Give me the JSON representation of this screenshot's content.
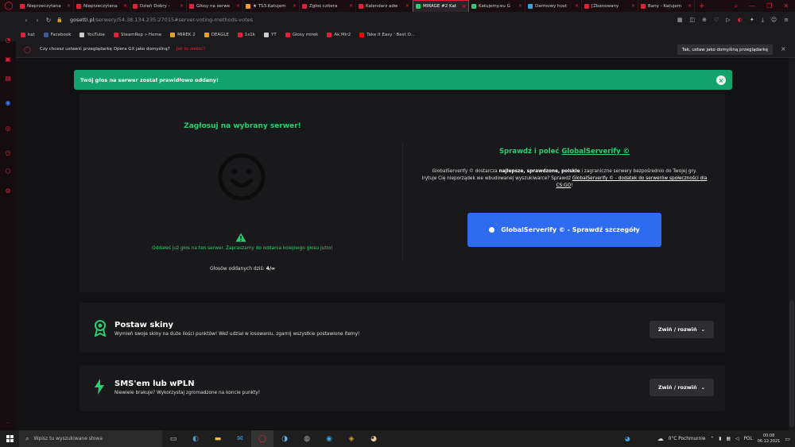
{
  "browser": {
    "tabs": [
      {
        "title": "Nieprzeczytana",
        "color": "#e0203a",
        "active": false
      },
      {
        "title": "Nieprzeczytana",
        "color": "#e0203a",
        "active": false
      },
      {
        "title": "Dzień Dobry - ",
        "color": "#e0203a",
        "active": false
      },
      {
        "title": "Głosy na serwe",
        "color": "#e0203a",
        "active": false
      },
      {
        "title": "★ TS3.Katujem",
        "color": "#f0a020",
        "active": false
      },
      {
        "title": "Zgłoś czitera",
        "color": "#e0203a",
        "active": false
      },
      {
        "title": "Kalendarz adw",
        "color": "#e0203a",
        "active": false
      },
      {
        "title": "MIRAGE #2 Kat",
        "color": "#2ecc71",
        "active": true
      },
      {
        "title": "Katujemy.eu G",
        "color": "#2ecc71",
        "active": false
      },
      {
        "title": "Darmowy host",
        "color": "#3aa0e0",
        "active": false
      },
      {
        "title": "[Zbanowany",
        "color": "#e0203a",
        "active": false
      },
      {
        "title": "Bany - Katujem",
        "color": "#e0203a",
        "active": false
      }
    ],
    "new_tab": "+",
    "url_host": "gosetti.pl",
    "url_path": "/serwery/54.38.134.235:27015#server-voting-methods-votes",
    "bookmarks": [
      {
        "label": "kat",
        "color": "#e0203a"
      },
      {
        "label": "Facebook",
        "color": "#3b5998"
      },
      {
        "label": "YouTube",
        "color": "#cccccc"
      },
      {
        "label": "SteamRep » Home",
        "color": "#e0203a"
      },
      {
        "label": "MIREK 2",
        "color": "#f0a020"
      },
      {
        "label": "DEAGLE",
        "color": "#f0a020"
      },
      {
        "label": "1s1k",
        "color": "#e0203a"
      },
      {
        "label": "YT",
        "color": "#cccccc"
      },
      {
        "label": "Głosy mirek",
        "color": "#e0203a"
      },
      {
        "label": "Ak Mir2",
        "color": "#e0203a"
      },
      {
        "label": "Take It Easy ' Best O...",
        "color": "#ff0000"
      }
    ],
    "infobar": {
      "message": "Czy chcesz ustawić przeglądarkę Opera GX jako domyślną?",
      "why_link": "Jak to zrobić?",
      "set_button": "Tak, ustaw jako domyślną przeglądarkę",
      "close": "×"
    }
  },
  "alert": {
    "text": "Twój głos na serwer został prawidłowo oddany!",
    "close": "×",
    "color": "#13a26d"
  },
  "vote": {
    "title": "Zagłosuj na wybrany serwer!",
    "message": "Oddałeś już głos na ten serwer. Zapraszamy do oddania kolejnego głosu jutro!",
    "votes_today_label": "Głosów oddanych dziś:",
    "votes_today_value": "4/∞"
  },
  "globalserverify": {
    "title_prefix": "Sprawdź i poleć ",
    "title_link": "GlobalServerify ©",
    "desc_1": "GlobalServerify © dostarcza ",
    "desc_bold_1": "najlepsze, sprawdzone, polskie",
    "desc_2": " i zagraniczne serwery bezpośrednio do Twojej gry.",
    "desc_3": "Irytuje Cię nieporządek we wbudowanej wyszukiwarce? Sprawdź ",
    "desc_link": "GlobalServerify © - dodatek do serwerów społeczności dla CS:GO",
    "desc_4": "!",
    "button": "GlobalServerify © - Sprawdź szczegóły",
    "button_color": "#2d6bf0"
  },
  "sections": {
    "skins": {
      "title": "Postaw skiny",
      "desc": "Wymień swoje skiny na duże ilości punktów! Weź udział w losowaniu, zgarnij wszystkie postawione itemy!",
      "toggle": "Zwiń / rozwiń"
    },
    "sms": {
      "title": "SMS'em lub wPLN",
      "desc": "Niewiele brakuje? Wykorzystaj zgromadzone na koncie punkty!",
      "toggle": "Zwiń / rozwiń"
    }
  },
  "taskbar": {
    "search_placeholder": "Wpisz tu wyszukiwane słowa",
    "weather": "0°C  Pochmurnie",
    "language": "POL",
    "time": "00:08",
    "date": "06.12.2021"
  },
  "accent_color": "#2ecc71"
}
